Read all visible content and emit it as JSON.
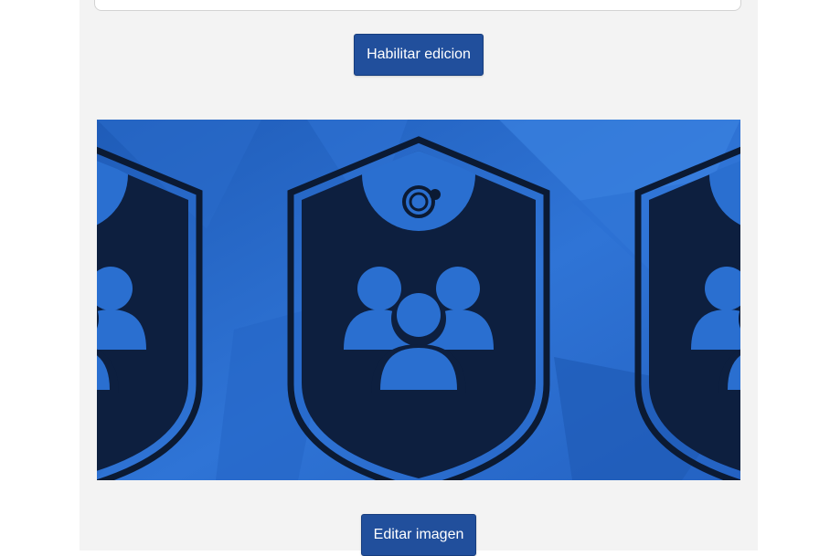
{
  "form": {
    "enable_edit_label": "Habilitar edicion",
    "edit_image_label": "Editar imagen"
  },
  "banner": {
    "icon": "shield-group-icon",
    "colors": {
      "background": "#2a6fd0",
      "shield": "#0d1f3f",
      "outline": "#0b1a33"
    }
  },
  "theme": {
    "button_bg": "#214f9c",
    "panel_bg": "#f3f3f3"
  }
}
